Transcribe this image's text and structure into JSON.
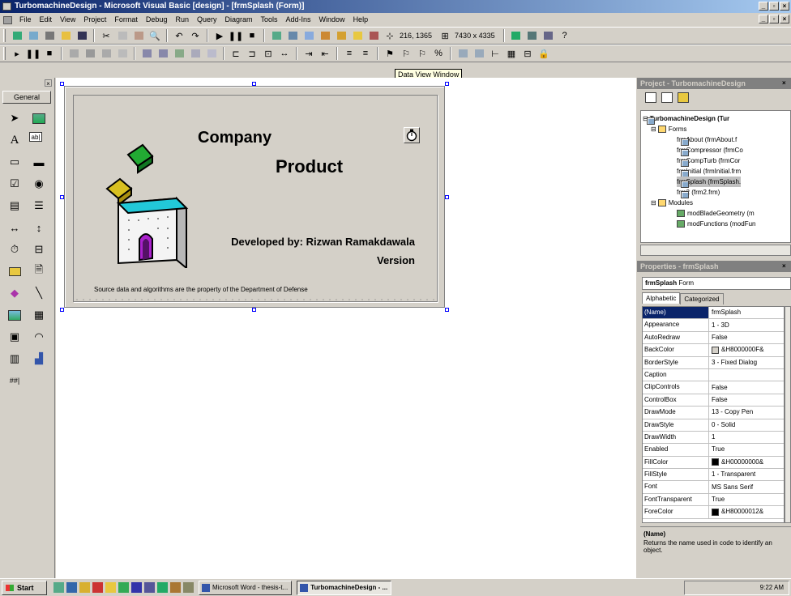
{
  "window": {
    "title": "TurbomachineDesign - Microsoft Visual Basic [design] - [frmSplash (Form)]"
  },
  "menu": [
    "File",
    "Edit",
    "View",
    "Project",
    "Format",
    "Debug",
    "Run",
    "Query",
    "Diagram",
    "Tools",
    "Add-Ins",
    "Window",
    "Help"
  ],
  "toolbar": {
    "position": "216, 1365",
    "size": "7430 x 4335"
  },
  "tooltip": "Data View Window",
  "toolbox": {
    "tab": "General"
  },
  "splash": {
    "company": "Company",
    "product": "Product",
    "developed_by": "Developed by: Rizwan Ramakdawala",
    "version": "Version",
    "footer": "Source data and algorithms are the property of the Department of Defense"
  },
  "project": {
    "title": "Project - TurbomachineDesign",
    "tree": [
      {
        "label": "TurbomachineDesign (Tur",
        "type": "project"
      },
      {
        "label": "Forms",
        "type": "folder"
      },
      {
        "label": "frmAbout (frmAbout.f",
        "type": "form"
      },
      {
        "label": "frmCompressor (frmCo",
        "type": "form"
      },
      {
        "label": "frmCompTurb (frmCor",
        "type": "form"
      },
      {
        "label": "frmInitial (frmInitial.frm",
        "type": "form"
      },
      {
        "label": "frmSplash (frmSplash.",
        "type": "form",
        "selected": true
      },
      {
        "label": "frm2 (frm2.frm)",
        "type": "form"
      },
      {
        "label": "Modules",
        "type": "folder"
      },
      {
        "label": "modBladeGeometry (m",
        "type": "module"
      },
      {
        "label": "modFunctions (modFun",
        "type": "module"
      }
    ]
  },
  "properties": {
    "title": "Properties - frmSplash",
    "object": "frmSplash",
    "object_type": "Form",
    "tabs": [
      "Alphabetic",
      "Categorized"
    ],
    "rows": [
      {
        "name": "(Name)",
        "value": "frmSplash",
        "selected": true
      },
      {
        "name": "Appearance",
        "value": "1 - 3D"
      },
      {
        "name": "AutoRedraw",
        "value": "False"
      },
      {
        "name": "BackColor",
        "value": "&H8000000F&",
        "swatch": "#d4d0c8"
      },
      {
        "name": "BorderStyle",
        "value": "3 - Fixed Dialog"
      },
      {
        "name": "Caption",
        "value": ""
      },
      {
        "name": "ClipControls",
        "value": "False"
      },
      {
        "name": "ControlBox",
        "value": "False"
      },
      {
        "name": "DrawMode",
        "value": "13 - Copy Pen"
      },
      {
        "name": "DrawStyle",
        "value": "0 - Solid"
      },
      {
        "name": "DrawWidth",
        "value": "1"
      },
      {
        "name": "Enabled",
        "value": "True"
      },
      {
        "name": "FillColor",
        "value": "&H00000000&",
        "swatch": "#000000"
      },
      {
        "name": "FillStyle",
        "value": "1 - Transparent"
      },
      {
        "name": "Font",
        "value": "MS Sans Serif"
      },
      {
        "name": "FontTransparent",
        "value": "True"
      },
      {
        "name": "ForeColor",
        "value": "&H80000012&",
        "swatch": "#000000"
      }
    ],
    "desc_title": "(Name)",
    "desc_text": "Returns the name used in code to identify an object."
  },
  "taskbar": {
    "start": "Start",
    "tasks": [
      "Microsoft Word - thesis-t...",
      "TurbomachineDesign - ..."
    ],
    "clock": "9:22 AM"
  }
}
